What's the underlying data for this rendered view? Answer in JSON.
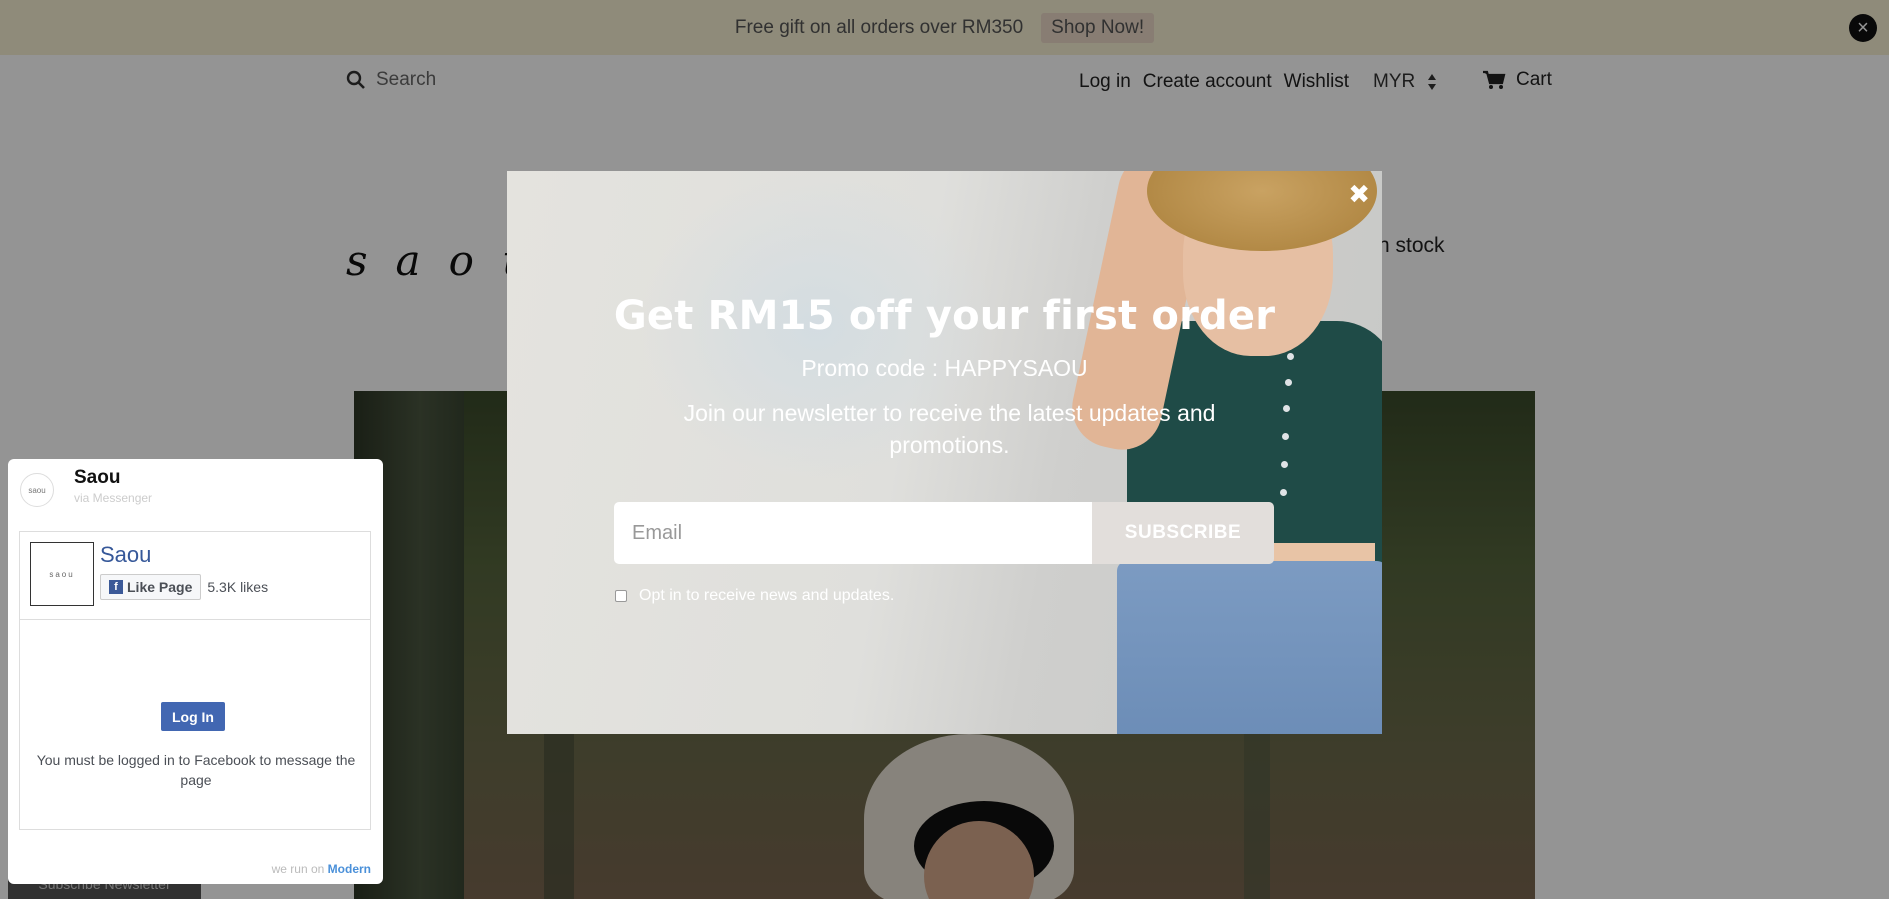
{
  "announcement": {
    "text": "Free gift on all orders over RM350",
    "cta": "Shop Now!"
  },
  "header": {
    "search_placeholder": "Search",
    "login": "Log in",
    "create_account": "Create account",
    "wishlist": "Wishlist",
    "currency": "MYR",
    "cart": "Cart"
  },
  "brand": {
    "logo_text": "saou",
    "stock_text": "k in stock"
  },
  "popup": {
    "title": "Get RM15 off your first order",
    "promo": "Promo code : HAPPYSAOU",
    "description": "Join our newsletter to receive the latest updates and promotions.",
    "email_placeholder": "Email",
    "subscribe_label": "SUBSCRIBE",
    "optin_label": "Opt in to receive news and updates."
  },
  "messenger": {
    "page_name": "Saou",
    "subtitle": "via Messenger",
    "avatar_text": "saou",
    "like_label": "Like Page",
    "likes": "5.3K likes",
    "login_label": "Log In",
    "message": "You must be logged in to Facebook to message the page",
    "footer_prefix": "we run on",
    "footer_brand": "Modern"
  },
  "subscribe_newsletter": "Subscribe Newsletter",
  "colors": {
    "announcement_bg": "#f6f0d2",
    "facebook_blue": "#4267b2",
    "popup_shirt": "#1f4b47"
  }
}
